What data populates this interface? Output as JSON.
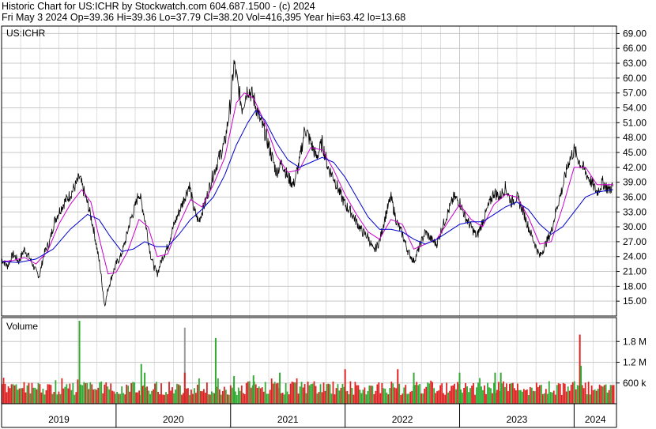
{
  "header": {
    "line1": "Historic Chart for US:ICHR by Stockwatch.com 604.687.1500 - (c) 2024",
    "line2": "Fri May  3 2024  Op=39.36  Hi=39.36  Lo=37.79  Cl=38.20  Vol=416,395  Year hi=63.42  lo=13.68"
  },
  "colors": {
    "price": "#000000",
    "ma_short": "#cc00cc",
    "ma_long": "#0000cc",
    "volume_up": "#33aa33",
    "volume_down": "#dd2222",
    "volume_neutral": "#999999",
    "grid": "#c8c8c8",
    "frame": "#000000"
  },
  "chart_data": [
    {
      "type": "line",
      "panel": "price",
      "label": "US:ICHR",
      "y_ticks": [
        "69.00",
        "66.00",
        "63.00",
        "60.00",
        "57.00",
        "54.00",
        "51.00",
        "48.00",
        "45.00",
        "42.00",
        "39.00",
        "36.00",
        "33.00",
        "30.00",
        "27.00",
        "24.00",
        "21.00",
        "18.00",
        "15.00"
      ],
      "ylim": [
        12.0,
        70.5
      ],
      "x_labels": [
        "2019",
        "2020",
        "2021",
        "2022",
        "2023",
        "2024"
      ],
      "x_domain": [
        2019.0,
        2024.37
      ],
      "grid": true,
      "series": [
        {
          "color_key": "price",
          "points": [
            [
              2019.0,
              23.5
            ],
            [
              2019.05,
              22.0
            ],
            [
              2019.1,
              24.5
            ],
            [
              2019.15,
              23.0
            ],
            [
              2019.2,
              25.5
            ],
            [
              2019.25,
              23.5
            ],
            [
              2019.3,
              21.0
            ],
            [
              2019.33,
              20.0
            ],
            [
              2019.37,
              24.5
            ],
            [
              2019.42,
              27.0
            ],
            [
              2019.46,
              31.0
            ],
            [
              2019.5,
              33.0
            ],
            [
              2019.55,
              35.0
            ],
            [
              2019.6,
              36.5
            ],
            [
              2019.65,
              38.5
            ],
            [
              2019.68,
              40.0
            ],
            [
              2019.72,
              37.0
            ],
            [
              2019.76,
              34.0
            ],
            [
              2019.8,
              30.0
            ],
            [
              2019.83,
              26.0
            ],
            [
              2019.86,
              22.0
            ],
            [
              2019.88,
              18.0
            ],
            [
              2019.9,
              14.0
            ],
            [
              2019.93,
              17.5
            ],
            [
              2019.97,
              20.5
            ],
            [
              2020.0,
              22.5
            ],
            [
              2020.04,
              24.0
            ],
            [
              2020.08,
              27.0
            ],
            [
              2020.12,
              31.0
            ],
            [
              2020.16,
              33.5
            ],
            [
              2020.2,
              37.0
            ],
            [
              2020.24,
              33.0
            ],
            [
              2020.27,
              29.0
            ],
            [
              2020.3,
              24.5
            ],
            [
              2020.33,
              22.0
            ],
            [
              2020.36,
              20.5
            ],
            [
              2020.4,
              23.5
            ],
            [
              2020.45,
              26.0
            ],
            [
              2020.5,
              30.0
            ],
            [
              2020.55,
              33.0
            ],
            [
              2020.6,
              36.0
            ],
            [
              2020.64,
              38.5
            ],
            [
              2020.68,
              33.5
            ],
            [
              2020.72,
              31.0
            ],
            [
              2020.78,
              35.0
            ],
            [
              2020.84,
              40.0
            ],
            [
              2020.9,
              44.0
            ],
            [
              2020.95,
              47.0
            ],
            [
              2021.0,
              55.0
            ],
            [
              2021.03,
              63.0
            ],
            [
              2021.06,
              59.0
            ],
            [
              2021.1,
              54.0
            ],
            [
              2021.15,
              58.0
            ],
            [
              2021.2,
              56.0
            ],
            [
              2021.25,
              52.0
            ],
            [
              2021.3,
              49.0
            ],
            [
              2021.35,
              45.0
            ],
            [
              2021.4,
              41.0
            ],
            [
              2021.45,
              43.0
            ],
            [
              2021.5,
              40.0
            ],
            [
              2021.55,
              38.5
            ],
            [
              2021.6,
              43.0
            ],
            [
              2021.65,
              50.0
            ],
            [
              2021.7,
              47.0
            ],
            [
              2021.75,
              44.0
            ],
            [
              2021.8,
              47.0
            ],
            [
              2021.85,
              42.0
            ],
            [
              2021.9,
              40.0
            ],
            [
              2021.95,
              37.0
            ],
            [
              2022.0,
              34.5
            ],
            [
              2022.05,
              33.0
            ],
            [
              2022.1,
              31.0
            ],
            [
              2022.15,
              29.0
            ],
            [
              2022.2,
              28.0
            ],
            [
              2022.25,
              25.0
            ],
            [
              2022.3,
              27.0
            ],
            [
              2022.35,
              32.0
            ],
            [
              2022.4,
              36.0
            ],
            [
              2022.45,
              31.0
            ],
            [
              2022.5,
              28.5
            ],
            [
              2022.55,
              25.0
            ],
            [
              2022.6,
              23.0
            ],
            [
              2022.65,
              26.0
            ],
            [
              2022.7,
              29.0
            ],
            [
              2022.75,
              27.5
            ],
            [
              2022.8,
              26.5
            ],
            [
              2022.85,
              30.0
            ],
            [
              2022.9,
              33.0
            ],
            [
              2022.95,
              36.0
            ],
            [
              2023.0,
              35.0
            ],
            [
              2023.05,
              32.0
            ],
            [
              2023.1,
              30.0
            ],
            [
              2023.15,
              28.0
            ],
            [
              2023.2,
              31.0
            ],
            [
              2023.25,
              34.0
            ],
            [
              2023.3,
              37.0
            ],
            [
              2023.35,
              36.0
            ],
            [
              2023.4,
              38.0
            ],
            [
              2023.45,
              35.0
            ],
            [
              2023.5,
              36.0
            ],
            [
              2023.55,
              33.5
            ],
            [
              2023.6,
              30.0
            ],
            [
              2023.65,
              27.0
            ],
            [
              2023.7,
              24.0
            ],
            [
              2023.75,
              26.5
            ],
            [
              2023.8,
              29.0
            ],
            [
              2023.85,
              34.0
            ],
            [
              2023.9,
              38.0
            ],
            [
              2023.95,
              43.0
            ],
            [
              2024.0,
              45.5
            ],
            [
              2024.05,
              43.0
            ],
            [
              2024.1,
              41.0
            ],
            [
              2024.15,
              39.0
            ],
            [
              2024.2,
              37.0
            ],
            [
              2024.25,
              39.0
            ],
            [
              2024.3,
              37.5
            ],
            [
              2024.34,
              38.2
            ]
          ]
        },
        {
          "color_key": "ma_short",
          "points": [
            [
              2019.0,
              23.0
            ],
            [
              2019.1,
              23.2
            ],
            [
              2019.2,
              23.8
            ],
            [
              2019.3,
              22.5
            ],
            [
              2019.4,
              25.0
            ],
            [
              2019.5,
              30.5
            ],
            [
              2019.6,
              34.5
            ],
            [
              2019.7,
              37.5
            ],
            [
              2019.78,
              35.0
            ],
            [
              2019.86,
              27.0
            ],
            [
              2019.93,
              20.5
            ],
            [
              2020.0,
              20.8
            ],
            [
              2020.1,
              25.0
            ],
            [
              2020.2,
              31.5
            ],
            [
              2020.28,
              30.0
            ],
            [
              2020.36,
              24.0
            ],
            [
              2020.45,
              24.5
            ],
            [
              2020.55,
              30.5
            ],
            [
              2020.65,
              35.5
            ],
            [
              2020.75,
              34.0
            ],
            [
              2020.85,
              38.5
            ],
            [
              2020.95,
              44.0
            ],
            [
              2021.05,
              55.0
            ],
            [
              2021.12,
              57.0
            ],
            [
              2021.2,
              56.0
            ],
            [
              2021.3,
              51.0
            ],
            [
              2021.4,
              44.5
            ],
            [
              2021.5,
              41.0
            ],
            [
              2021.6,
              41.5
            ],
            [
              2021.7,
              46.0
            ],
            [
              2021.8,
              45.5
            ],
            [
              2021.9,
              41.5
            ],
            [
              2022.0,
              36.5
            ],
            [
              2022.1,
              32.5
            ],
            [
              2022.2,
              29.0
            ],
            [
              2022.3,
              27.5
            ],
            [
              2022.4,
              31.5
            ],
            [
              2022.5,
              30.5
            ],
            [
              2022.6,
              25.5
            ],
            [
              2022.7,
              26.5
            ],
            [
              2022.8,
              27.5
            ],
            [
              2022.9,
              31.0
            ],
            [
              2023.0,
              34.5
            ],
            [
              2023.1,
              31.5
            ],
            [
              2023.2,
              30.0
            ],
            [
              2023.3,
              34.5
            ],
            [
              2023.4,
              36.5
            ],
            [
              2023.5,
              36.0
            ],
            [
              2023.6,
              32.0
            ],
            [
              2023.7,
              26.5
            ],
            [
              2023.8,
              27.0
            ],
            [
              2023.9,
              34.0
            ],
            [
              2024.0,
              42.0
            ],
            [
              2024.1,
              42.0
            ],
            [
              2024.2,
              38.5
            ],
            [
              2024.34,
              38.5
            ]
          ]
        },
        {
          "color_key": "ma_long",
          "points": [
            [
              2019.0,
              23.0
            ],
            [
              2019.15,
              22.8
            ],
            [
              2019.3,
              23.5
            ],
            [
              2019.45,
              25.5
            ],
            [
              2019.6,
              29.5
            ],
            [
              2019.75,
              32.5
            ],
            [
              2019.85,
              31.5
            ],
            [
              2019.95,
              28.0
            ],
            [
              2020.05,
              25.0
            ],
            [
              2020.15,
              25.5
            ],
            [
              2020.25,
              27.0
            ],
            [
              2020.35,
              26.0
            ],
            [
              2020.45,
              26.0
            ],
            [
              2020.55,
              28.5
            ],
            [
              2020.65,
              31.5
            ],
            [
              2020.75,
              33.5
            ],
            [
              2020.85,
              36.0
            ],
            [
              2020.95,
              40.5
            ],
            [
              2021.05,
              46.5
            ],
            [
              2021.15,
              51.0
            ],
            [
              2021.22,
              53.5
            ],
            [
              2021.3,
              51.5
            ],
            [
              2021.4,
              47.0
            ],
            [
              2021.5,
              43.5
            ],
            [
              2021.6,
              42.0
            ],
            [
              2021.7,
              43.0
            ],
            [
              2021.8,
              44.0
            ],
            [
              2021.9,
              43.0
            ],
            [
              2022.0,
              40.0
            ],
            [
              2022.1,
              36.0
            ],
            [
              2022.2,
              32.0
            ],
            [
              2022.3,
              29.5
            ],
            [
              2022.4,
              29.5
            ],
            [
              2022.5,
              29.0
            ],
            [
              2022.6,
              27.5
            ],
            [
              2022.7,
              26.5
            ],
            [
              2022.8,
              27.5
            ],
            [
              2022.9,
              29.0
            ],
            [
              2023.0,
              30.5
            ],
            [
              2023.1,
              31.0
            ],
            [
              2023.2,
              31.0
            ],
            [
              2023.3,
              32.5
            ],
            [
              2023.4,
              34.0
            ],
            [
              2023.5,
              35.0
            ],
            [
              2023.6,
              33.5
            ],
            [
              2023.7,
              30.5
            ],
            [
              2023.8,
              28.5
            ],
            [
              2023.9,
              30.0
            ],
            [
              2024.0,
              33.0
            ],
            [
              2024.1,
              36.0
            ],
            [
              2024.2,
              37.0
            ],
            [
              2024.34,
              37.5
            ]
          ]
        }
      ]
    },
    {
      "type": "bar",
      "panel": "volume",
      "label": "Volume",
      "unit": "shares",
      "y_ticks": [
        "1.8 M",
        "1.2 M",
        "600 k"
      ],
      "y_tick_values": [
        1800000,
        1200000,
        600000
      ],
      "ylim": [
        0,
        2400000
      ],
      "grid": true,
      "spikes": [
        {
          "x": 2019.68,
          "value": 2400000,
          "color_key": "volume_up"
        },
        {
          "x": 2020.6,
          "value": 2200000,
          "color_key": "volume_neutral"
        },
        {
          "x": 2020.87,
          "value": 1900000,
          "color_key": "volume_up"
        },
        {
          "x": 2020.22,
          "value": 1150000,
          "color_key": "volume_up"
        },
        {
          "x": 2020.25,
          "value": 900000,
          "color_key": "volume_up"
        },
        {
          "x": 2020.6,
          "value": 900000,
          "color_key": "volume_down"
        },
        {
          "x": 2021.03,
          "value": 800000,
          "color_key": "volume_up"
        },
        {
          "x": 2021.2,
          "value": 820000,
          "color_key": "volume_up"
        },
        {
          "x": 2021.43,
          "value": 900000,
          "color_key": "volume_up"
        },
        {
          "x": 2022.0,
          "value": 1000000,
          "color_key": "volume_down"
        },
        {
          "x": 2022.46,
          "value": 1000000,
          "color_key": "volume_down"
        },
        {
          "x": 2022.6,
          "value": 900000,
          "color_key": "volume_up"
        },
        {
          "x": 2023.0,
          "value": 900000,
          "color_key": "volume_up"
        },
        {
          "x": 2023.31,
          "value": 900000,
          "color_key": "volume_up"
        },
        {
          "x": 2023.36,
          "value": 900000,
          "color_key": "volume_up"
        },
        {
          "x": 2024.05,
          "value": 2000000,
          "color_key": "volume_down"
        },
        {
          "x": 2024.06,
          "value": 1100000,
          "color_key": "volume_up"
        }
      ],
      "typical_low": 250000,
      "typical_high": 650000
    }
  ]
}
